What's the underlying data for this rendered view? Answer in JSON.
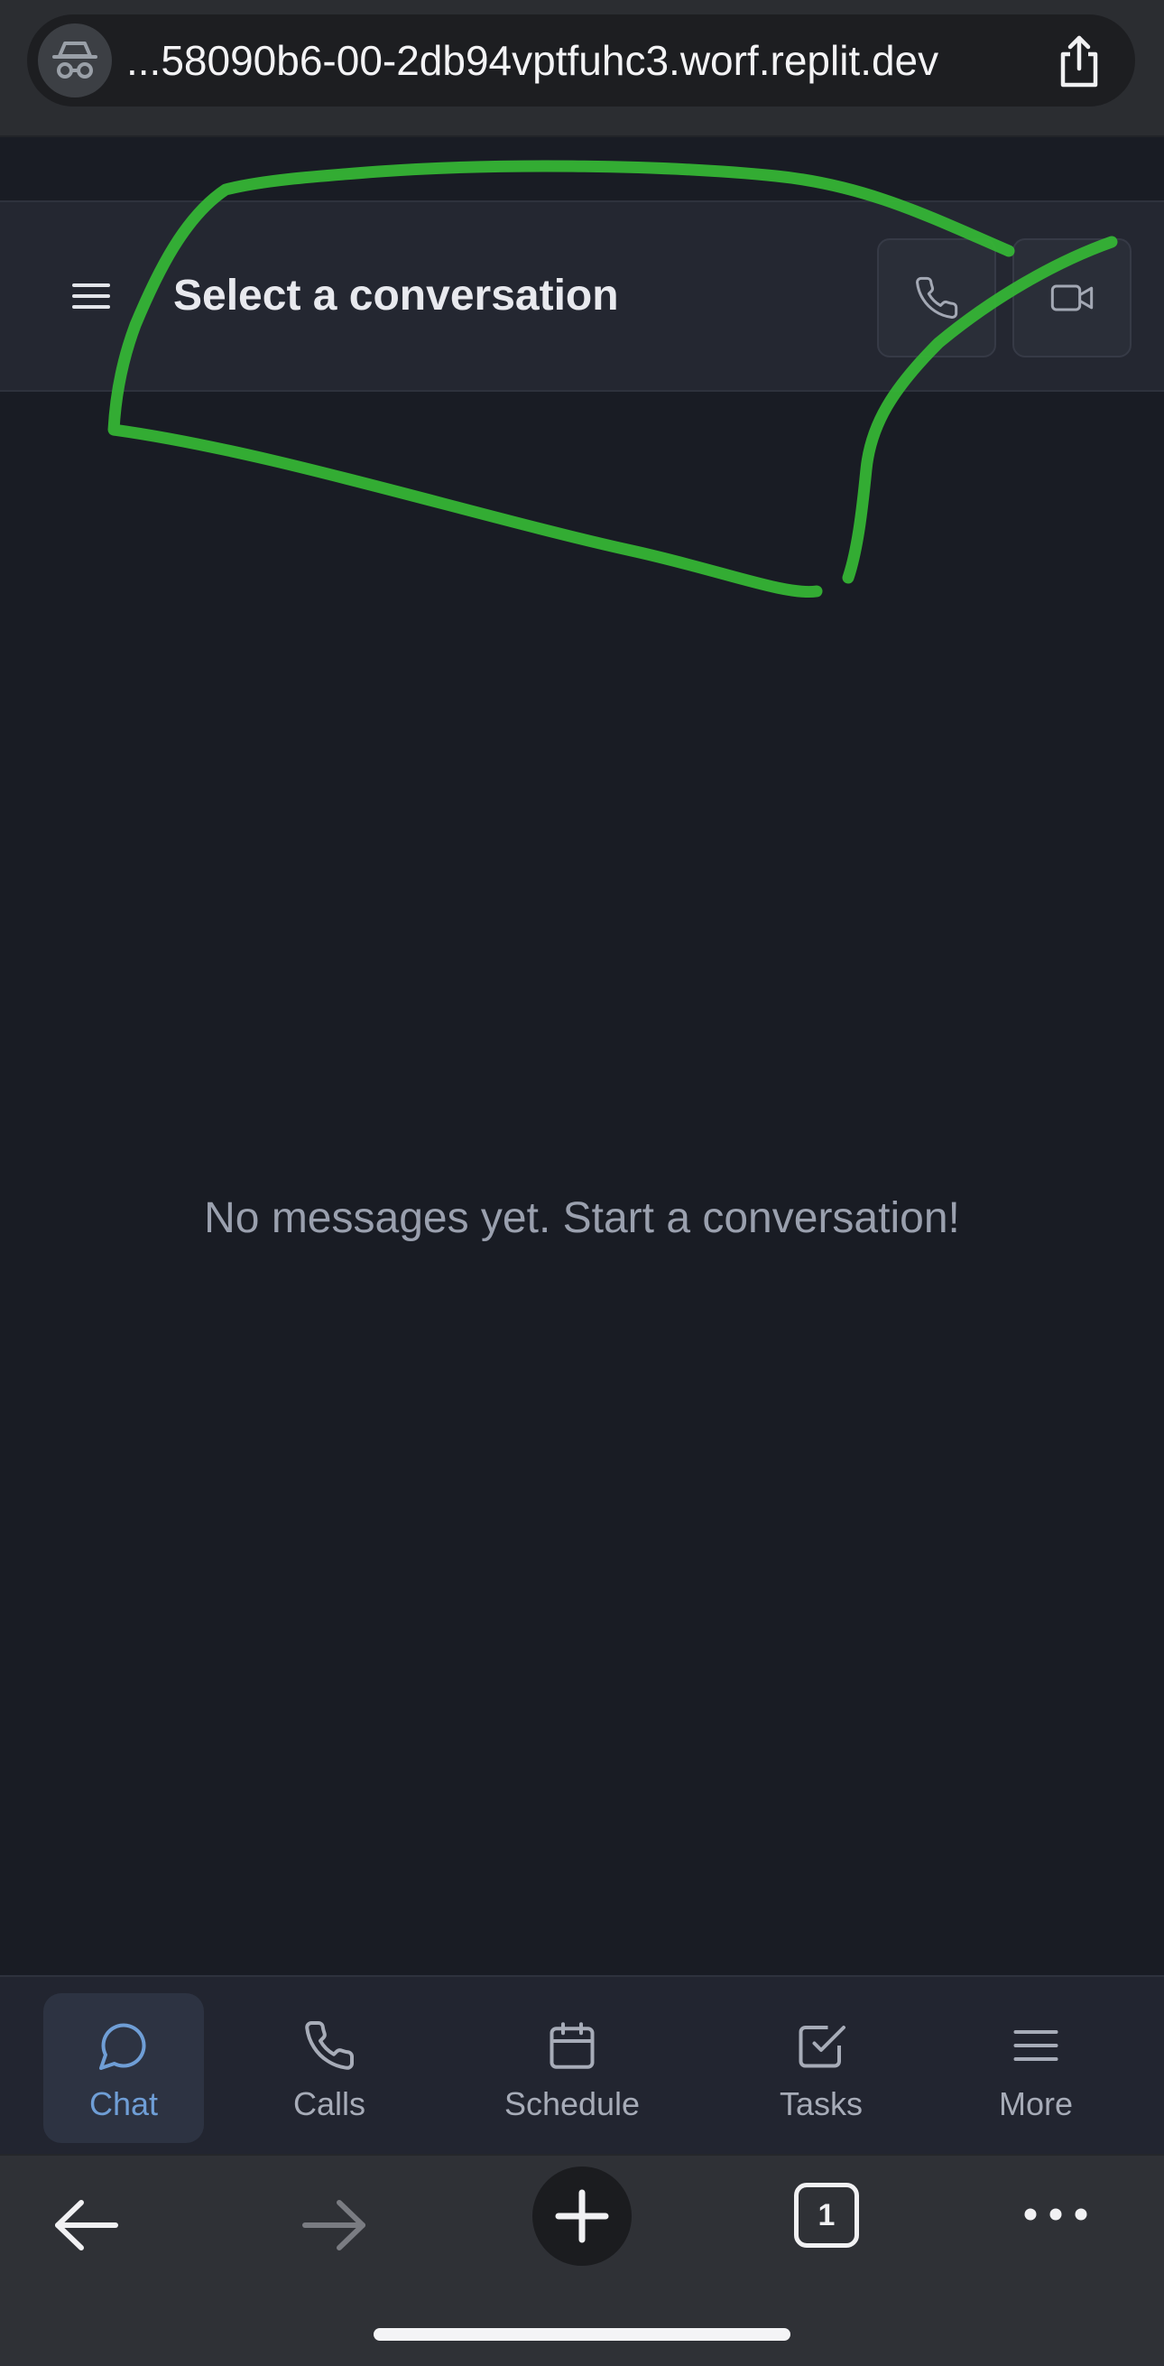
{
  "browser": {
    "url": "...58090b6-00-2db94vptfuhc3.worf.replit.dev",
    "incognito_icon": "incognito-icon",
    "share_icon": "share-icon",
    "tab_count": "1"
  },
  "header": {
    "title": "Select a conversation",
    "menu_icon": "hamburger-icon",
    "call_icon": "phone-icon",
    "video_icon": "video-icon"
  },
  "main": {
    "empty_message": "No messages yet. Start a conversation!"
  },
  "tabs": [
    {
      "label": "Chat",
      "icon": "chat-bubble-icon",
      "active": true
    },
    {
      "label": "Calls",
      "icon": "phone-icon",
      "active": false
    },
    {
      "label": "Schedule",
      "icon": "calendar-icon",
      "active": false
    },
    {
      "label": "Tasks",
      "icon": "check-square-icon",
      "active": false
    },
    {
      "label": "More",
      "icon": "menu-icon",
      "active": false
    }
  ],
  "colors": {
    "background": "#191c24",
    "header": "#242731",
    "accent": "#6f9ed6",
    "annotation": "#3ec23e"
  }
}
